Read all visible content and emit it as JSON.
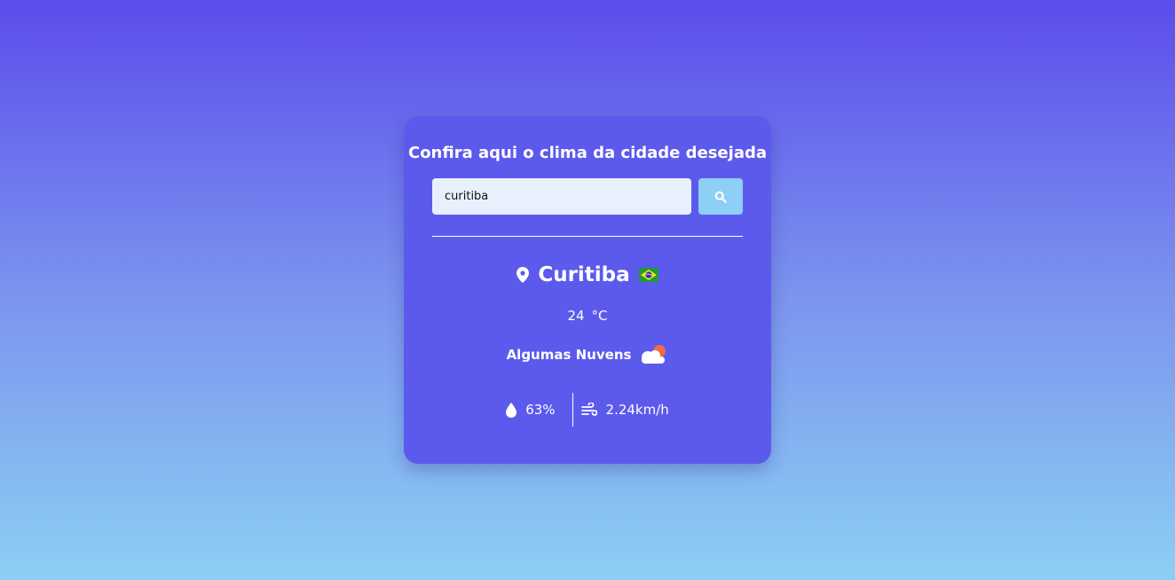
{
  "title": "Confira aqui o clima da cidade desejada",
  "search": {
    "value": "curitiba",
    "button_icon": "search-icon"
  },
  "city": {
    "name": "Curitiba",
    "icon": "map-pin-icon",
    "flag": "brazil-flag-icon"
  },
  "temperature": {
    "value": "24",
    "unit": "°C"
  },
  "description": {
    "text": "Algumas Nuvens",
    "icon": "partly-cloudy-icon"
  },
  "humidity": {
    "value": "63%",
    "icon": "water-drop-icon"
  },
  "wind": {
    "value": "2.24km/h",
    "icon": "wind-icon"
  },
  "colors": {
    "card": "#5c5aec",
    "button": "#8dcff5",
    "input_bg": "#e8f0fd",
    "gradient_top": "#5b4cec",
    "gradient_bottom": "#8ccff4"
  }
}
